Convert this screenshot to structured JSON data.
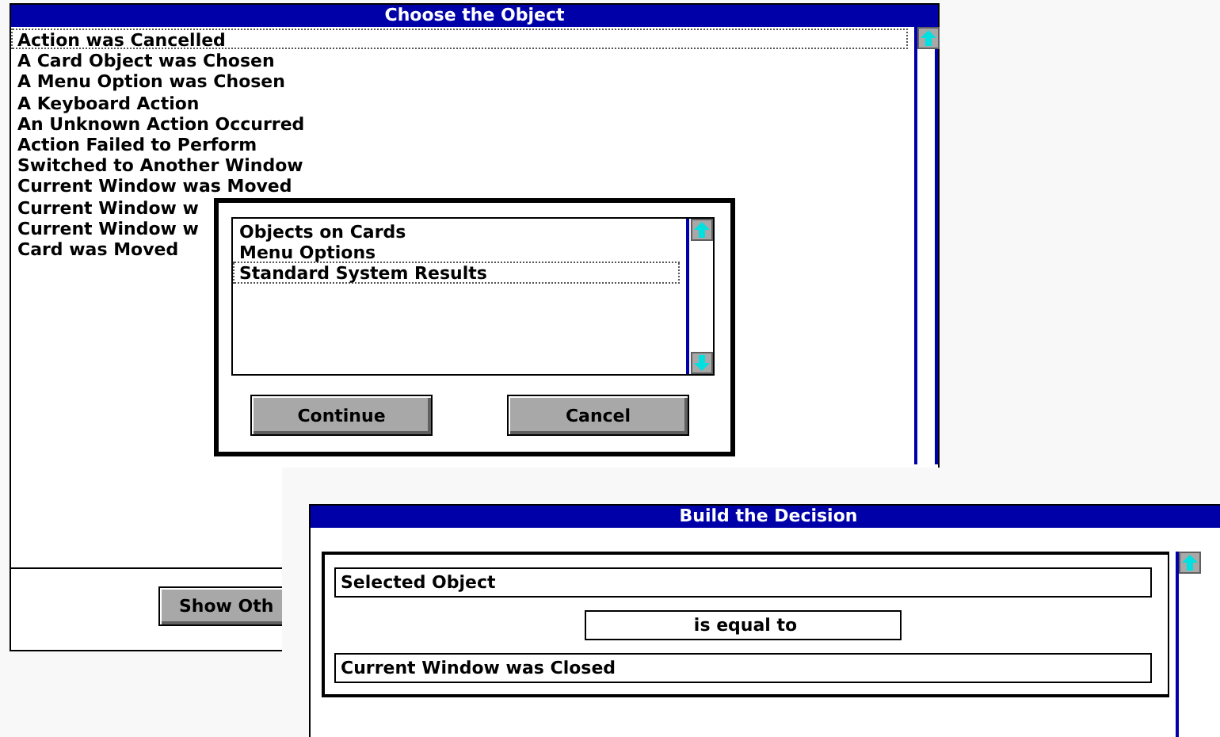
{
  "windows": [
    {
      "kind": "list_window",
      "title": "Choose the Object",
      "items": [
        {
          "label": "Action was Cancelled",
          "focused": true
        },
        {
          "label": "A Card Object was Chosen",
          "focused": false
        },
        {
          "label": "A Menu Option was Chosen",
          "focused": false
        },
        {
          "label": "A Keyboard Action",
          "focused": false
        },
        {
          "label": "An Unknown Action Occurred",
          "focused": false
        },
        {
          "label": "Action Failed to Perform",
          "focused": false
        },
        {
          "label": "Switched to Another Window",
          "focused": false
        },
        {
          "label": "Current Window was Moved",
          "focused": false
        },
        {
          "label": "Current Window w",
          "focused": false
        },
        {
          "label": "Current Window w",
          "focused": false
        },
        {
          "label": "Card was Moved",
          "focused": false
        }
      ],
      "buttons": [
        "Show Oth"
      ]
    },
    {
      "kind": "dialog",
      "items": [
        {
          "label": "Objects on Cards",
          "focused": false
        },
        {
          "label": "Menu Options",
          "focused": false
        },
        {
          "label": "Standard System Results",
          "focused": true
        }
      ],
      "buttons": [
        "Continue",
        "Cancel"
      ]
    },
    {
      "kind": "decision_window",
      "title": "Build the Decision",
      "fields": [
        "Selected Object",
        "is equal to",
        "Current Window was Closed"
      ]
    }
  ]
}
